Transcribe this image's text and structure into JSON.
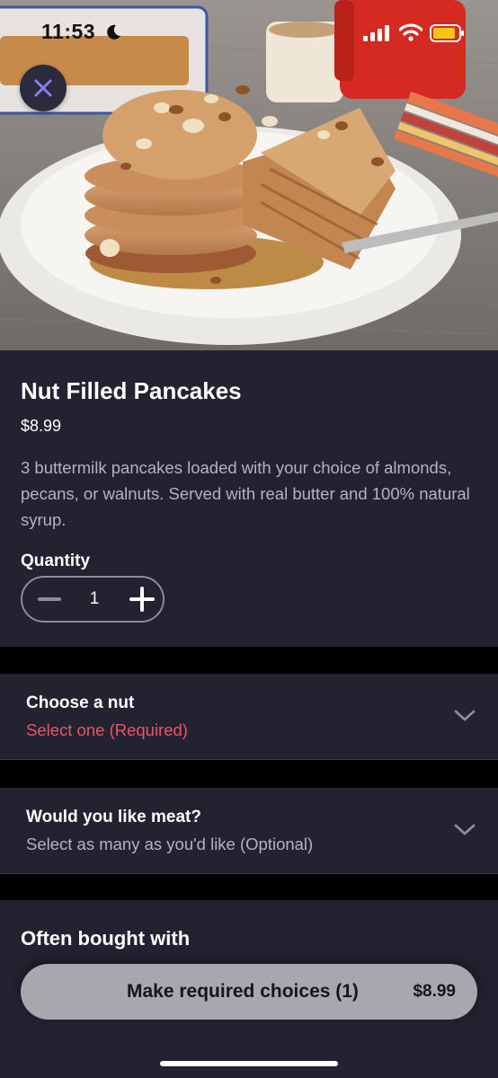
{
  "status_bar": {
    "time": "11:53",
    "icons": [
      "moon-icon",
      "signal-icon",
      "wifi-icon",
      "battery-icon"
    ],
    "battery_color": "#f5c518"
  },
  "header": {
    "close_icon": "close-icon",
    "close_icon_color": "#8b7bf0"
  },
  "item": {
    "title": "Nut Filled Pancakes",
    "price": "$8.99",
    "description": "3 buttermilk pancakes loaded with your choice of almonds, pecans, or walnuts. Served with real butter and 100% natural syrup."
  },
  "quantity": {
    "label": "Quantity",
    "value": "1",
    "decrement_icon": "minus-icon",
    "increment_icon": "plus-icon"
  },
  "options": [
    {
      "title": "Choose a nut",
      "subtitle": "Select one (Required)",
      "required": true,
      "icon": "chevron-down-icon"
    },
    {
      "title": "Would you like meat?",
      "subtitle": "Select as many as you'd like (Optional)",
      "required": false,
      "icon": "chevron-down-icon"
    }
  ],
  "often_bought": {
    "title": "Often bought with"
  },
  "cta": {
    "label": "Make required choices (1)",
    "price": "$8.99"
  },
  "colors": {
    "background": "#000000",
    "panel": "#222230",
    "required_text": "#e8566a",
    "secondary_text": "#b4b4bf",
    "cta_background": "#a7a7ad"
  }
}
